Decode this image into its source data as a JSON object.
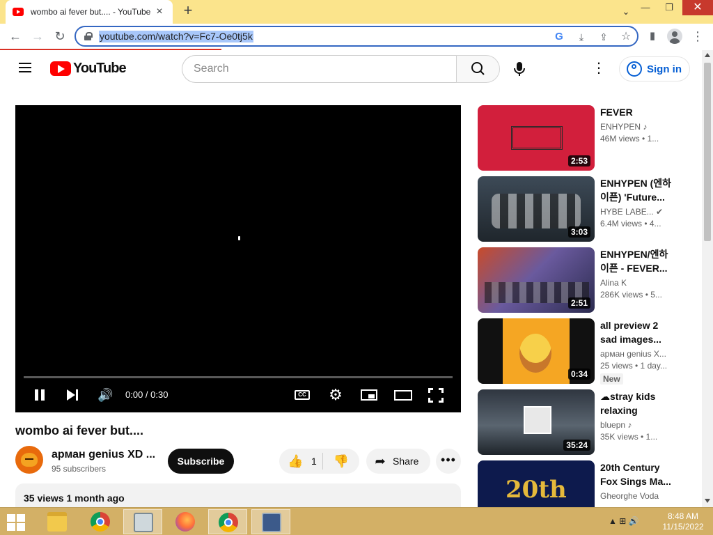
{
  "browser": {
    "tab_title": "wombo ai fever but.... - YouTube",
    "tab_close": "×",
    "new_tab": "+",
    "url": "youtube.com/watch?v=Fc7-Oe0tj5k",
    "back": "←",
    "forward": "→",
    "reload": "↻",
    "window_chevron": "⌄",
    "window_minimize": "—",
    "window_maximize": "❐",
    "window_close": "✕",
    "google_lens": "G",
    "install": "⤓",
    "share": "⇪",
    "bookmark": "☆",
    "side_panel": "▮",
    "menu": "⋮"
  },
  "header": {
    "logo_text": "YouTube",
    "search_placeholder": "Search",
    "search_icon": "⌕",
    "mic_icon": "🎙",
    "more_icon": "⋮",
    "signin_label": "Sign in"
  },
  "player": {
    "time": "0:00 / 0:30",
    "volume_icon": "🔊",
    "cc_label": "CC",
    "settings_icon": "⚙"
  },
  "video": {
    "title": "wombo ai fever but....",
    "channel_name": "арман genius XD ...",
    "subscribers": "95 subscribers",
    "subscribe_label": "Subscribe",
    "like_count": "1",
    "like_icon": "👍",
    "dislike_icon": "👎",
    "share_label": "Share",
    "share_icon": "➦",
    "more_label": "•••",
    "views_date": "35 views  1 month ago"
  },
  "related": [
    {
      "title": "FEVER",
      "channel": "ENHYPEN ♪",
      "views": "46M views  • 1...",
      "duration": "2:53",
      "badge": ""
    },
    {
      "title": "ENHYPEN (엔하이픈) 'Future...",
      "channel": "HYBE LABE... ✔",
      "views": "6.4M views  • 4...",
      "duration": "3:03",
      "badge": ""
    },
    {
      "title": "ENHYPEN/엔하이픈 - FEVER...",
      "channel": "Alina K",
      "views": "286K views  • 5...",
      "duration": "2:51",
      "badge": ""
    },
    {
      "title": "all preview 2 sad images...",
      "channel": "арман genius X...",
      "views": "25 views  • 1 day...",
      "duration": "0:34",
      "badge": "New"
    },
    {
      "title": "☁stray kids relaxing playli...",
      "channel": "bluepn ♪",
      "views": "35K views  • 1...",
      "duration": "35:24",
      "badge": ""
    },
    {
      "title": "20th Century Fox Sings Ma...",
      "channel": "Gheorghe Voda",
      "views": "",
      "duration": "",
      "badge": ""
    }
  ],
  "taskbar": {
    "time": "8:48 AM",
    "date": "11/15/2022",
    "tray_icons": "▲  ⊞  🔊"
  },
  "colors": {
    "youtube_red": "#ff0000",
    "link_blue": "#065fd4",
    "taskbar": "#d3b066",
    "tabstrip": "#fbe48c",
    "window_close": "#c7392d"
  }
}
